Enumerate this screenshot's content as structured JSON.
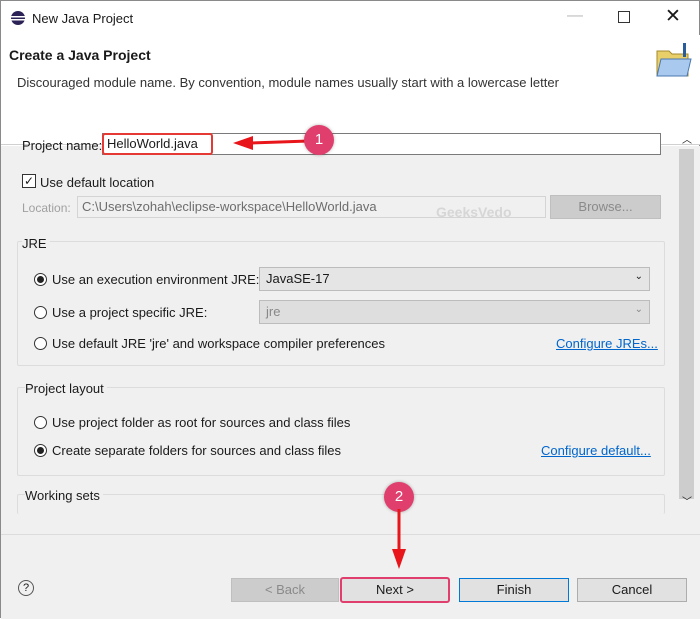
{
  "window": {
    "title": "New Java Project",
    "icon": "eclipse-icon"
  },
  "header": {
    "title": "Create a Java Project",
    "message": "Discouraged module name. By convention, module names usually start with a lowercase letter",
    "icon": "folder-icon"
  },
  "project_name": {
    "label": "Project name:",
    "value": "HelloWorld.java"
  },
  "default_location": {
    "label": "Use default location",
    "checked": true
  },
  "location": {
    "label": "Location:",
    "value": "C:\\Users\\zohah\\eclipse-workspace\\HelloWorld.java",
    "browse": "Browse..."
  },
  "watermark": "GeeksVedo",
  "jre": {
    "title": "JRE",
    "options": [
      {
        "label": "Use an execution environment JRE:",
        "value": "JavaSE-17",
        "selected": true
      },
      {
        "label": "Use a project specific JRE:",
        "value": "jre",
        "selected": false
      },
      {
        "label": "Use default JRE 'jre' and workspace compiler preferences",
        "selected": false
      }
    ],
    "configure_link": "Configure JREs..."
  },
  "layout": {
    "title": "Project layout",
    "options": [
      {
        "label": "Use project folder as root for sources and class files",
        "selected": false
      },
      {
        "label": "Create separate folders for sources and class files",
        "selected": true
      }
    ],
    "configure_link": "Configure default..."
  },
  "working_sets": {
    "title": "Working sets"
  },
  "callouts": [
    "1",
    "2"
  ],
  "buttons": {
    "back": "< Back",
    "next": "Next >",
    "finish": "Finish",
    "cancel": "Cancel"
  },
  "colors": {
    "callout": "#e03f6d",
    "arrow": "#e8161b",
    "link": "#0066cc"
  }
}
